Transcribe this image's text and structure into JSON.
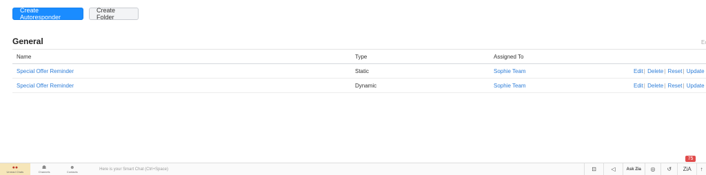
{
  "toolbar": {
    "create_autoresponder": "Create Autoresponder",
    "create_folder": "Create Folder"
  },
  "section": {
    "title": "General",
    "edit_corner": "Ec"
  },
  "table": {
    "headers": [
      "Name",
      "Type",
      "Assigned To"
    ],
    "rows": [
      {
        "name": "Special Offer Reminder",
        "type": "Static",
        "assigned": "Sophie Team"
      },
      {
        "name": "Special Offer Reminder",
        "type": "Dynamic",
        "assigned": "Sophie Team"
      }
    ],
    "actions": [
      "Edit",
      "Delete",
      "Reset",
      "Update"
    ]
  },
  "bottom_bar": {
    "tabs": [
      {
        "label": "Unread Chats",
        "icon": "chat-bubbles-icon"
      },
      {
        "label": "Channels",
        "icon": "channels-icon"
      },
      {
        "label": "Contacts",
        "icon": "contacts-icon"
      }
    ],
    "smart_chat_placeholder": "Here is your Smart Chat (Ctrl+Space)",
    "ask_zia": "Ask Zia",
    "zia_label": "ZiA",
    "badge_count": "75"
  }
}
